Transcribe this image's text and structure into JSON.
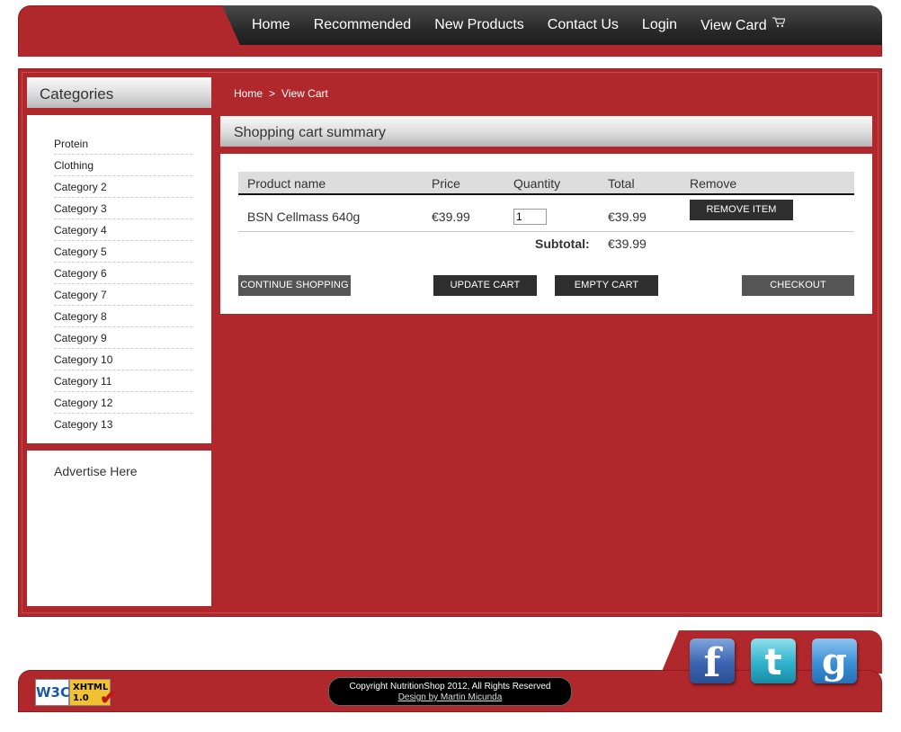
{
  "nav": {
    "items": [
      "Home",
      "Recommended",
      "New Products",
      "Contact Us",
      "Login",
      "View Card"
    ],
    "cart_icon": "shopping-cart-icon"
  },
  "sidebar": {
    "categories_title": "Categories",
    "categories": [
      "Protein",
      "Clothing",
      "Category 2",
      "Category 3",
      "Category 4",
      "Category 5",
      "Category 6",
      "Category 7",
      "Category 8",
      "Category 9",
      "Category 10",
      "Category 11",
      "Category 12",
      "Category 13"
    ],
    "advertise": "Advertise Here"
  },
  "breadcrumb": {
    "home": "Home",
    "separator": ">",
    "current": "View Cart"
  },
  "cart": {
    "title": "Shopping cart summary",
    "columns": {
      "product": "Product name",
      "price": "Price",
      "quantity": "Quantity",
      "total": "Total",
      "remove": "Remove"
    },
    "items": [
      {
        "name": "BSN Cellmass 640g",
        "price": "€39.99",
        "quantity": "1",
        "total": "€39.99",
        "remove_label": "REMOVE ITEM"
      }
    ],
    "subtotal_label": "Subtotal:",
    "subtotal_value": "€39.99",
    "buttons": {
      "continue": "CONTINUE SHOPPING",
      "update": "UPDATE CART",
      "empty": "EMPTY CART",
      "checkout": "CHECKOUT"
    }
  },
  "footer": {
    "copyright": "Copyright NutritionShop 2012, All Rights Reserved",
    "design": "Design by Martin Micunda",
    "w3c": {
      "logo": "W3C",
      "line1": "XHTML",
      "line2": "1.0"
    },
    "social": {
      "facebook": "f",
      "twitter": "t",
      "google": "g"
    }
  },
  "colors": {
    "brand_red": "#b0282b",
    "nav_dark": "#2a2a2a",
    "button_dark": "#2e2e2e",
    "button_grey": "#555555"
  }
}
